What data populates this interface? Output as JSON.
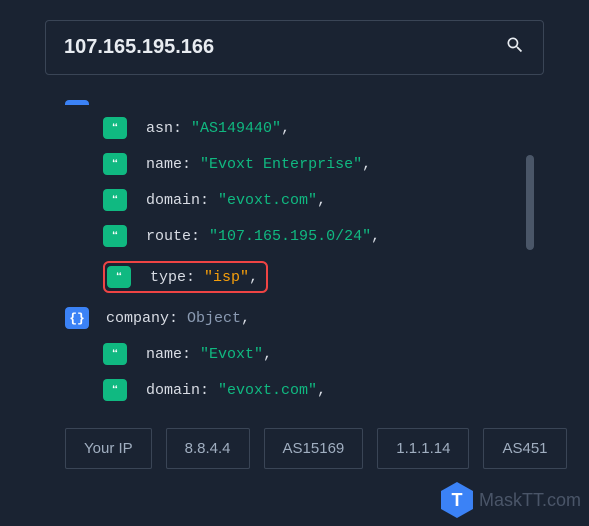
{
  "search": {
    "value": "107.165.195.166"
  },
  "json": {
    "asn": {
      "key": "asn",
      "value": "\"AS149440\""
    },
    "name": {
      "key": "name",
      "value": "\"Evoxt Enterprise\""
    },
    "domain": {
      "key": "domain",
      "value": "\"evoxt.com\""
    },
    "route": {
      "key": "route",
      "value": "\"107.165.195.0/24\""
    },
    "type": {
      "key": "type",
      "value": "\"isp\""
    },
    "company": {
      "key": "company",
      "type": "Object"
    },
    "company_name": {
      "key": "name",
      "value": "\"Evoxt\""
    },
    "company_domain": {
      "key": "domain",
      "value": "\"evoxt.com\""
    }
  },
  "buttons": {
    "your_ip": "Your IP",
    "ip2": "8.8.4.4",
    "asn1": "AS15169",
    "ip3": "1.1.1.14",
    "asn2": "AS451"
  },
  "watermark": {
    "letter": "T",
    "text": "MaskTT.com"
  },
  "badges": {
    "object": "{}",
    "string": "❝"
  }
}
